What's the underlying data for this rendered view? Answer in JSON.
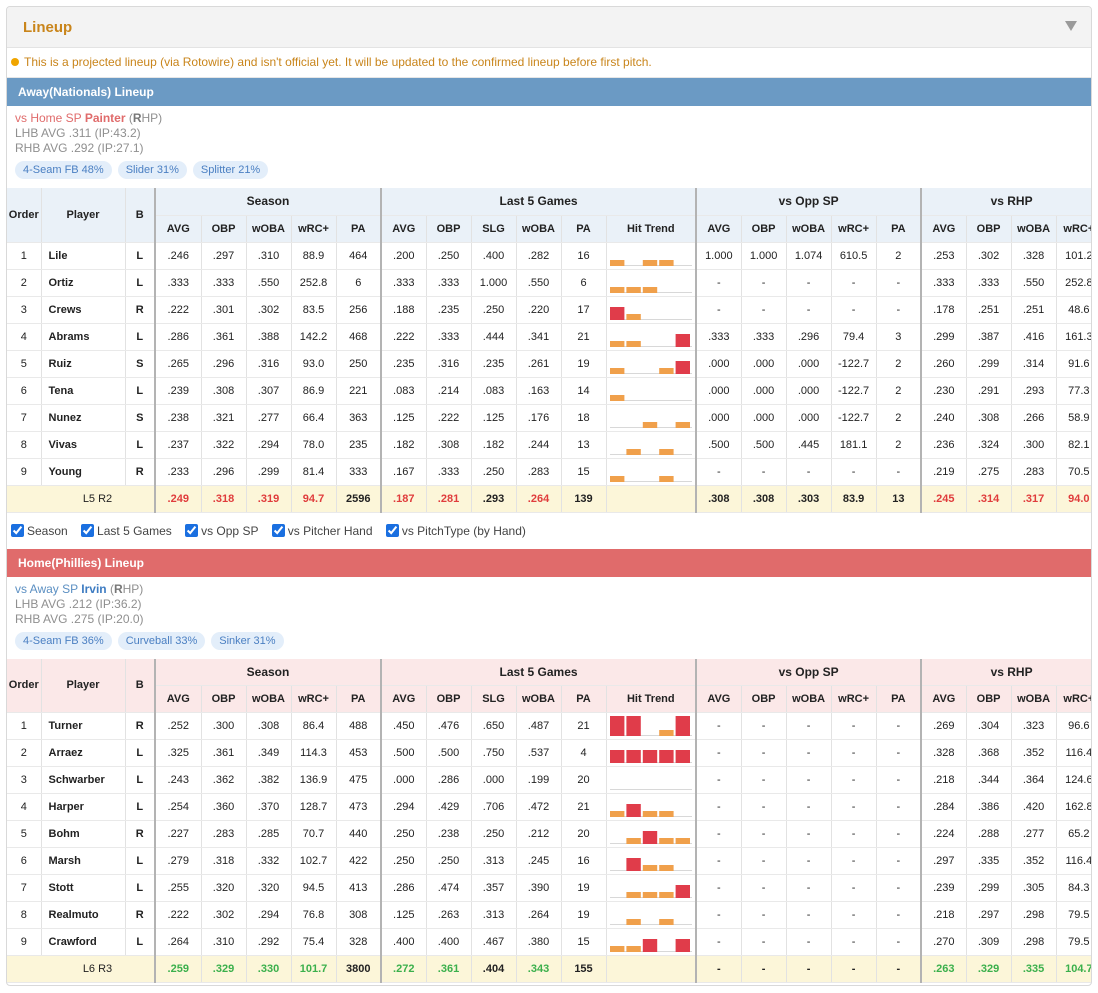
{
  "panel": {
    "title": "Lineup",
    "notice": "This is a projected lineup (via Rotowire) and isn't official yet. It will be updated to the confirmed lineup before first pitch."
  },
  "colors": {
    "accent": "#c9851b",
    "away_bar": "#6b9ac4",
    "home_bar": "#e06b6b",
    "trend_low": "#f0a04b",
    "trend_high": "#e03c4a",
    "highlight_red": "#e03c3c",
    "highlight_green": "#3bb04c"
  },
  "headers": {
    "order": "Order",
    "player": "Player",
    "bats": "B",
    "groups": {
      "season": "Season",
      "last5": "Last 5 Games",
      "vsopp": "vs Opp SP",
      "vshand": "vs RHP"
    },
    "cols": {
      "avg": "AVG",
      "obp": "OBP",
      "woba": "wOBA",
      "wrc": "wRC+",
      "pa": "PA",
      "slg": "SLG",
      "trend": "Hit Trend"
    }
  },
  "away": {
    "bar": "Away(Nationals) Lineup",
    "sp": {
      "prefix": "vs Home SP",
      "name": "Painter",
      "hand_open": "(",
      "hand": "R",
      "hand_rest": "HP)"
    },
    "lhb": "LHB AVG .311 (IP:43.2)",
    "rhb": "RHB AVG .292 (IP:27.1)",
    "pitches": [
      "4-Seam FB 48%",
      "Slider 31%",
      "Splitter 21%"
    ],
    "rows": [
      {
        "order": "1",
        "name": "Lile",
        "bats": "L",
        "s_avg": ".246",
        "s_obp": ".297",
        "s_woba": ".310",
        "s_wrc": "88.9",
        "s_pa": "464",
        "l_avg": ".200",
        "l_obp": ".250",
        "l_slg": ".400",
        "l_woba": ".282",
        "l_pa": "16",
        "trend": [
          1,
          0,
          1,
          1,
          0
        ],
        "o_avg": "1.000",
        "o_obp": "1.000",
        "o_woba": "1.074",
        "o_wrc": "610.5",
        "o_pa": "2",
        "h_avg": ".253",
        "h_obp": ".302",
        "h_woba": ".328",
        "h_wrc": "101.2"
      },
      {
        "order": "2",
        "name": "Ortiz",
        "bats": "L",
        "s_avg": ".333",
        "s_obp": ".333",
        "s_woba": ".550",
        "s_wrc": "252.8",
        "s_pa": "6",
        "l_avg": ".333",
        "l_obp": ".333",
        "l_slg": "1.000",
        "l_woba": ".550",
        "l_pa": "6",
        "trend": [
          1,
          1,
          1,
          0,
          0
        ],
        "o_avg": "-",
        "o_obp": "-",
        "o_woba": "-",
        "o_wrc": "-",
        "o_pa": "-",
        "h_avg": ".333",
        "h_obp": ".333",
        "h_woba": ".550",
        "h_wrc": "252.8"
      },
      {
        "order": "3",
        "name": "Crews",
        "bats": "R",
        "s_avg": ".222",
        "s_obp": ".301",
        "s_woba": ".302",
        "s_wrc": "83.5",
        "s_pa": "256",
        "l_avg": ".188",
        "l_obp": ".235",
        "l_slg": ".250",
        "l_woba": ".220",
        "l_pa": "17",
        "trend": [
          2,
          1,
          0,
          0,
          0
        ],
        "o_avg": "-",
        "o_obp": "-",
        "o_woba": "-",
        "o_wrc": "-",
        "o_pa": "-",
        "h_avg": ".178",
        "h_obp": ".251",
        "h_woba": ".251",
        "h_wrc": "48.6"
      },
      {
        "order": "4",
        "name": "Abrams",
        "bats": "L",
        "s_avg": ".286",
        "s_obp": ".361",
        "s_woba": ".388",
        "s_wrc": "142.2",
        "s_pa": "468",
        "l_avg": ".222",
        "l_obp": ".333",
        "l_slg": ".444",
        "l_woba": ".341",
        "l_pa": "21",
        "trend": [
          1,
          1,
          0,
          0,
          2
        ],
        "o_avg": ".333",
        "o_obp": ".333",
        "o_woba": ".296",
        "o_wrc": "79.4",
        "o_pa": "3",
        "h_avg": ".299",
        "h_obp": ".387",
        "h_woba": ".416",
        "h_wrc": "161.3"
      },
      {
        "order": "5",
        "name": "Ruiz",
        "bats": "S",
        "s_avg": ".265",
        "s_obp": ".296",
        "s_woba": ".316",
        "s_wrc": "93.0",
        "s_pa": "250",
        "l_avg": ".235",
        "l_obp": ".316",
        "l_slg": ".235",
        "l_woba": ".261",
        "l_pa": "19",
        "trend": [
          1,
          0,
          0,
          1,
          2
        ],
        "o_avg": ".000",
        "o_obp": ".000",
        "o_woba": ".000",
        "o_wrc": "-122.7",
        "o_pa": "2",
        "h_avg": ".260",
        "h_obp": ".299",
        "h_woba": ".314",
        "h_wrc": "91.6"
      },
      {
        "order": "6",
        "name": "Tena",
        "bats": "L",
        "s_avg": ".239",
        "s_obp": ".308",
        "s_woba": ".307",
        "s_wrc": "86.9",
        "s_pa": "221",
        "l_avg": ".083",
        "l_obp": ".214",
        "l_slg": ".083",
        "l_woba": ".163",
        "l_pa": "14",
        "trend": [
          1,
          0,
          0,
          0,
          0
        ],
        "o_avg": ".000",
        "o_obp": ".000",
        "o_woba": ".000",
        "o_wrc": "-122.7",
        "o_pa": "2",
        "h_avg": ".230",
        "h_obp": ".291",
        "h_woba": ".293",
        "h_wrc": "77.3"
      },
      {
        "order": "7",
        "name": "Nunez",
        "bats": "S",
        "s_avg": ".238",
        "s_obp": ".321",
        "s_woba": ".277",
        "s_wrc": "66.4",
        "s_pa": "363",
        "l_avg": ".125",
        "l_obp": ".222",
        "l_slg": ".125",
        "l_woba": ".176",
        "l_pa": "18",
        "trend": [
          0,
          0,
          1,
          0,
          1
        ],
        "o_avg": ".000",
        "o_obp": ".000",
        "o_woba": ".000",
        "o_wrc": "-122.7",
        "o_pa": "2",
        "h_avg": ".240",
        "h_obp": ".308",
        "h_woba": ".266",
        "h_wrc": "58.9"
      },
      {
        "order": "8",
        "name": "Vivas",
        "bats": "L",
        "s_avg": ".237",
        "s_obp": ".322",
        "s_woba": ".294",
        "s_wrc": "78.0",
        "s_pa": "235",
        "l_avg": ".182",
        "l_obp": ".308",
        "l_slg": ".182",
        "l_woba": ".244",
        "l_pa": "13",
        "trend": [
          0,
          1,
          0,
          1,
          0
        ],
        "o_avg": ".500",
        "o_obp": ".500",
        "o_woba": ".445",
        "o_wrc": "181.1",
        "o_pa": "2",
        "h_avg": ".236",
        "h_obp": ".324",
        "h_woba": ".300",
        "h_wrc": "82.1"
      },
      {
        "order": "9",
        "name": "Young",
        "bats": "R",
        "s_avg": ".233",
        "s_obp": ".296",
        "s_woba": ".299",
        "s_wrc": "81.4",
        "s_pa": "333",
        "l_avg": ".167",
        "l_obp": ".333",
        "l_slg": ".250",
        "l_woba": ".283",
        "l_pa": "15",
        "trend": [
          1,
          0,
          0,
          1,
          0
        ],
        "o_avg": "-",
        "o_obp": "-",
        "o_woba": "-",
        "o_wrc": "-",
        "o_pa": "-",
        "h_avg": ".219",
        "h_obp": ".275",
        "h_woba": ".283",
        "h_wrc": "70.5"
      }
    ],
    "total": {
      "label": "L5 R2",
      "s_avg": ".249",
      "s_obp": ".318",
      "s_woba": ".319",
      "s_wrc": "94.7",
      "s_pa": "2596",
      "l_avg": ".187",
      "l_obp": ".281",
      "l_slg": ".293",
      "l_woba": ".264",
      "l_pa": "139",
      "o_avg": ".308",
      "o_obp": ".308",
      "o_woba": ".303",
      "o_wrc": "83.9",
      "o_pa": "13",
      "h_avg": ".245",
      "h_obp": ".314",
      "h_woba": ".317",
      "h_wrc": "94.0"
    }
  },
  "toggles": [
    "Season",
    "Last 5 Games",
    "vs Opp SP",
    "vs Pitcher Hand",
    "vs PitchType (by Hand)"
  ],
  "home": {
    "bar": "Home(Phillies) Lineup",
    "sp": {
      "prefix": "vs Away SP",
      "name": "Irvin",
      "hand_open": "(",
      "hand": "R",
      "hand_rest": "HP)"
    },
    "lhb": "LHB AVG .212 (IP:36.2)",
    "rhb": "RHB AVG .275 (IP:20.0)",
    "pitches": [
      "4-Seam FB 36%",
      "Curveball 33%",
      "Sinker 31%"
    ],
    "rows": [
      {
        "order": "1",
        "name": "Turner",
        "bats": "R",
        "s_avg": ".252",
        "s_obp": ".300",
        "s_woba": ".308",
        "s_wrc": "86.4",
        "s_pa": "488",
        "l_avg": ".450",
        "l_obp": ".476",
        "l_slg": ".650",
        "l_woba": ".487",
        "l_pa": "21",
        "trend": [
          3,
          3,
          0,
          1,
          3
        ],
        "o_avg": "-",
        "o_obp": "-",
        "o_woba": "-",
        "o_wrc": "-",
        "o_pa": "-",
        "h_avg": ".269",
        "h_obp": ".304",
        "h_woba": ".323",
        "h_wrc": "96.6"
      },
      {
        "order": "2",
        "name": "Arraez",
        "bats": "L",
        "s_avg": ".325",
        "s_obp": ".361",
        "s_woba": ".349",
        "s_wrc": "114.3",
        "s_pa": "453",
        "l_avg": ".500",
        "l_obp": ".500",
        "l_slg": ".750",
        "l_woba": ".537",
        "l_pa": "4",
        "trend": [
          2,
          2,
          2,
          2,
          2
        ],
        "o_avg": "-",
        "o_obp": "-",
        "o_woba": "-",
        "o_wrc": "-",
        "o_pa": "-",
        "h_avg": ".328",
        "h_obp": ".368",
        "h_woba": ".352",
        "h_wrc": "116.4"
      },
      {
        "order": "3",
        "name": "Schwarber",
        "bats": "L",
        "s_avg": ".243",
        "s_obp": ".362",
        "s_woba": ".382",
        "s_wrc": "136.9",
        "s_pa": "475",
        "l_avg": ".000",
        "l_obp": ".286",
        "l_slg": ".000",
        "l_woba": ".199",
        "l_pa": "20",
        "trend": [
          0,
          0,
          0,
          0,
          0
        ],
        "o_avg": "-",
        "o_obp": "-",
        "o_woba": "-",
        "o_wrc": "-",
        "o_pa": "-",
        "h_avg": ".218",
        "h_obp": ".344",
        "h_woba": ".364",
        "h_wrc": "124.6"
      },
      {
        "order": "4",
        "name": "Harper",
        "bats": "L",
        "s_avg": ".254",
        "s_obp": ".360",
        "s_woba": ".370",
        "s_wrc": "128.7",
        "s_pa": "473",
        "l_avg": ".294",
        "l_obp": ".429",
        "l_slg": ".706",
        "l_woba": ".472",
        "l_pa": "21",
        "trend": [
          1,
          2,
          1,
          1,
          0
        ],
        "o_avg": "-",
        "o_obp": "-",
        "o_woba": "-",
        "o_wrc": "-",
        "o_pa": "-",
        "h_avg": ".284",
        "h_obp": ".386",
        "h_woba": ".420",
        "h_wrc": "162.8"
      },
      {
        "order": "5",
        "name": "Bohm",
        "bats": "R",
        "s_avg": ".227",
        "s_obp": ".283",
        "s_woba": ".285",
        "s_wrc": "70.7",
        "s_pa": "440",
        "l_avg": ".250",
        "l_obp": ".238",
        "l_slg": ".250",
        "l_woba": ".212",
        "l_pa": "20",
        "trend": [
          0,
          1,
          2,
          1,
          1
        ],
        "o_avg": "-",
        "o_obp": "-",
        "o_woba": "-",
        "o_wrc": "-",
        "o_pa": "-",
        "h_avg": ".224",
        "h_obp": ".288",
        "h_woba": ".277",
        "h_wrc": "65.2"
      },
      {
        "order": "6",
        "name": "Marsh",
        "bats": "L",
        "s_avg": ".279",
        "s_obp": ".318",
        "s_woba": ".332",
        "s_wrc": "102.7",
        "s_pa": "422",
        "l_avg": ".250",
        "l_obp": ".250",
        "l_slg": ".313",
        "l_woba": ".245",
        "l_pa": "16",
        "trend": [
          0,
          2,
          1,
          1,
          0
        ],
        "o_avg": "-",
        "o_obp": "-",
        "o_woba": "-",
        "o_wrc": "-",
        "o_pa": "-",
        "h_avg": ".297",
        "h_obp": ".335",
        "h_woba": ".352",
        "h_wrc": "116.4"
      },
      {
        "order": "7",
        "name": "Stott",
        "bats": "L",
        "s_avg": ".255",
        "s_obp": ".320",
        "s_woba": ".320",
        "s_wrc": "94.5",
        "s_pa": "413",
        "l_avg": ".286",
        "l_obp": ".474",
        "l_slg": ".357",
        "l_woba": ".390",
        "l_pa": "19",
        "trend": [
          0,
          1,
          1,
          1,
          2
        ],
        "o_avg": "-",
        "o_obp": "-",
        "o_woba": "-",
        "o_wrc": "-",
        "o_pa": "-",
        "h_avg": ".239",
        "h_obp": ".299",
        "h_woba": ".305",
        "h_wrc": "84.3"
      },
      {
        "order": "8",
        "name": "Realmuto",
        "bats": "R",
        "s_avg": ".222",
        "s_obp": ".302",
        "s_woba": ".294",
        "s_wrc": "76.8",
        "s_pa": "308",
        "l_avg": ".125",
        "l_obp": ".263",
        "l_slg": ".313",
        "l_woba": ".264",
        "l_pa": "19",
        "trend": [
          0,
          1,
          0,
          1,
          0
        ],
        "o_avg": "-",
        "o_obp": "-",
        "o_woba": "-",
        "o_wrc": "-",
        "o_pa": "-",
        "h_avg": ".218",
        "h_obp": ".297",
        "h_woba": ".298",
        "h_wrc": "79.5"
      },
      {
        "order": "9",
        "name": "Crawford",
        "bats": "L",
        "s_avg": ".264",
        "s_obp": ".310",
        "s_woba": ".292",
        "s_wrc": "75.4",
        "s_pa": "328",
        "l_avg": ".400",
        "l_obp": ".400",
        "l_slg": ".467",
        "l_woba": ".380",
        "l_pa": "15",
        "trend": [
          1,
          1,
          2,
          0,
          2
        ],
        "o_avg": "-",
        "o_obp": "-",
        "o_woba": "-",
        "o_wrc": "-",
        "o_pa": "-",
        "h_avg": ".270",
        "h_obp": ".309",
        "h_woba": ".298",
        "h_wrc": "79.5"
      }
    ],
    "total": {
      "label": "L6 R3",
      "s_avg": ".259",
      "s_obp": ".329",
      "s_woba": ".330",
      "s_wrc": "101.7",
      "s_pa": "3800",
      "l_avg": ".272",
      "l_obp": ".361",
      "l_slg": ".404",
      "l_woba": ".343",
      "l_pa": "155",
      "o_avg": "-",
      "o_obp": "-",
      "o_woba": "-",
      "o_wrc": "-",
      "o_pa": "-",
      "h_avg": ".263",
      "h_obp": ".329",
      "h_woba": ".335",
      "h_wrc": "104.7"
    }
  }
}
